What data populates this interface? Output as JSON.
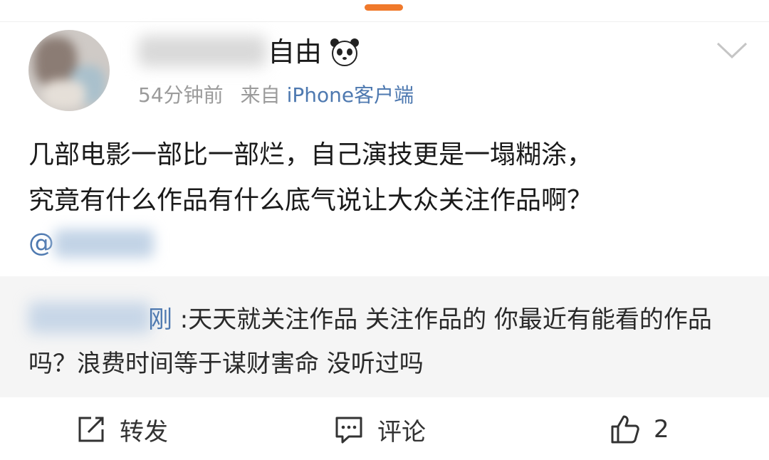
{
  "post": {
    "author_name_visible": "自由",
    "author_badge_icon": "panda-icon",
    "timestamp": "54分钟前",
    "source_prefix": "来自",
    "source_client": "iPhone客户端",
    "text_line1": "几部电影一部比一部烂，自己演技更是一塌糊涂，",
    "text_line2": "究竟有什么作品有什么底气说让大众关注作品啊？",
    "mention_prefix": "@"
  },
  "reply": {
    "user_suffix": "刚",
    "text": " :天天就关注作品 关注作品的 你最近有能看的作品吗？浪费时间等于谋财害命 没听过吗"
  },
  "actions": {
    "repost_label": "转发",
    "comment_label": "评论",
    "like_count": "2"
  },
  "colors": {
    "link": "#4e79b0",
    "accent": "#f0792b",
    "reply_bg": "#f5f5f5"
  }
}
